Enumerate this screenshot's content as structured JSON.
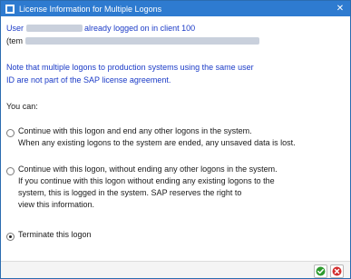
{
  "window": {
    "title": "License Information for Multiple Logons",
    "close_glyph": "✕",
    "icon": "sap-app-icon"
  },
  "message": {
    "line1_prefix": "User",
    "line1_suffix": "already logged on in client 100",
    "line2_prefix": "(tem",
    "note_line1": "Note that multiple logons to production systems using the same user",
    "note_line2": "ID are not part of the SAP license agreement.",
    "you_can": "You can:"
  },
  "options": [
    {
      "lines": [
        "Continue with this logon and end any other logons in the system.",
        "When any existing logons to the system are ended, any unsaved data is lost."
      ],
      "selected": false
    },
    {
      "lines": [
        "Continue with this logon, without ending any other logons in the system.",
        "If you continue with this logon without ending any existing logons to the",
        "system, this is logged in the system. SAP reserves the right to",
        "view this information."
      ],
      "selected": false
    },
    {
      "lines": [
        "Terminate this logon"
      ],
      "selected": true
    }
  ],
  "footer": {
    "confirm_icon": "checkmark-icon",
    "cancel_icon": "cancel-icon",
    "confirm_color": "#2e9b2e",
    "cancel_color": "#d32f2f"
  },
  "colors": {
    "titlebar": "#2e7bd0",
    "message_blue": "#1b3bc7"
  }
}
